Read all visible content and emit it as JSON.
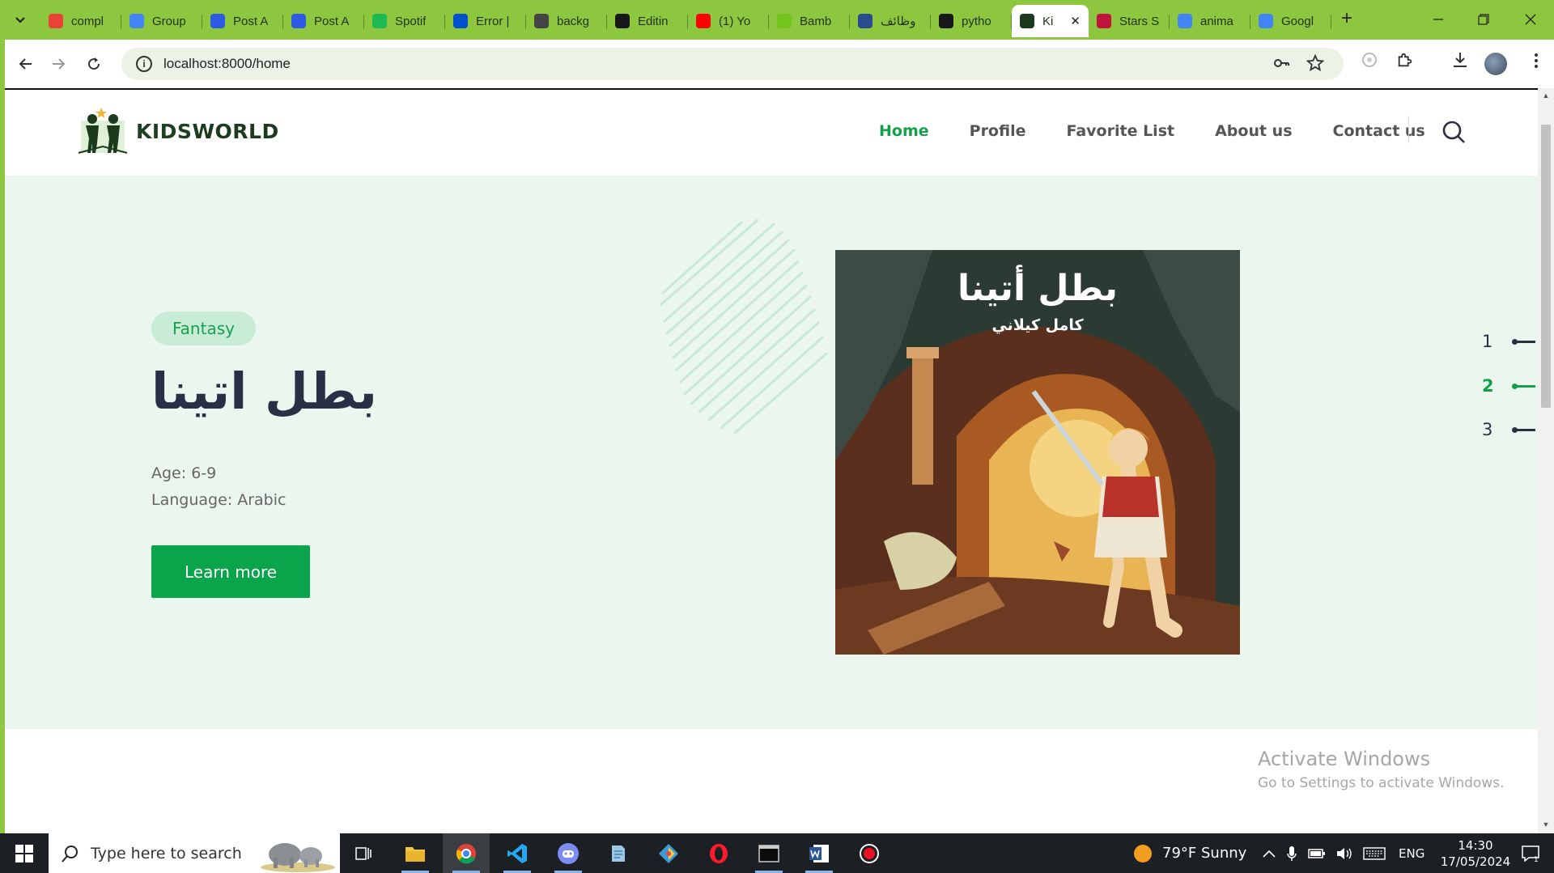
{
  "browser": {
    "tabs": [
      {
        "title": "compl",
        "favicon": "gmail-icon",
        "color": "#ea4335"
      },
      {
        "title": "Group",
        "favicon": "google-docs-icon",
        "color": "#4285f4"
      },
      {
        "title": "Post A",
        "favicon": "zoom-icon",
        "color": "#2d5be3"
      },
      {
        "title": "Post A",
        "favicon": "zoom-icon",
        "color": "#2d5be3"
      },
      {
        "title": "Spotif",
        "favicon": "spotify-icon",
        "color": "#1db954"
      },
      {
        "title": "Error |",
        "favicon": "trello-icon",
        "color": "#0052cc"
      },
      {
        "title": "backg",
        "favicon": "stack-icon",
        "color": "#444444"
      },
      {
        "title": "Editin",
        "favicon": "github-icon",
        "color": "#181717"
      },
      {
        "title": "(1) Yo",
        "favicon": "youtube-icon",
        "color": "#ff0000"
      },
      {
        "title": "Bamb",
        "favicon": "bamboo-icon",
        "color": "#73c41d"
      },
      {
        "title": "وظائف",
        "favicon": "site-icon",
        "color": "#2a4b8d"
      },
      {
        "title": "pytho",
        "favicon": "spotify-dark-icon",
        "color": "#181818"
      },
      {
        "title": "Ki",
        "favicon": "kidsworld-icon",
        "color": "#1c3a1e",
        "active": true
      },
      {
        "title": "Stars S",
        "favicon": "book-icon",
        "color": "#c0143c"
      },
      {
        "title": "anima",
        "favicon": "google-icon",
        "color": "#4285f4"
      },
      {
        "title": "Googl",
        "favicon": "google-translate-icon",
        "color": "#4285f4"
      }
    ],
    "url": "localhost:8000/home"
  },
  "site": {
    "logo_text_kids": "KIDS",
    "logo_text_world": "WORLD",
    "nav": {
      "home": "Home",
      "profile": "Profile",
      "favorites": "Favorite List",
      "about": "About us",
      "contact": "Contact us"
    },
    "hero": {
      "genre": "Fantasy",
      "title": "بطل اتينا",
      "age": "Age: 6-9",
      "language": "Language: Arabic",
      "button": "Learn more",
      "cover_title": "بطل أتينا",
      "cover_author": "كامل كيلاني",
      "slides": [
        "1",
        "2",
        "3"
      ],
      "active_slide": 2
    },
    "watermark_title": "Activate Windows",
    "watermark_sub": "Go to Settings to activate Windows."
  },
  "taskbar": {
    "search_placeholder": "Type here to search",
    "weather": "79°F  Sunny",
    "language": "ENG",
    "time": "14:30",
    "date": "17/05/2024"
  },
  "colors": {
    "accent": "#14a04a",
    "chrome": "#8dc63f",
    "hero_bg": "#eaf6ee"
  }
}
